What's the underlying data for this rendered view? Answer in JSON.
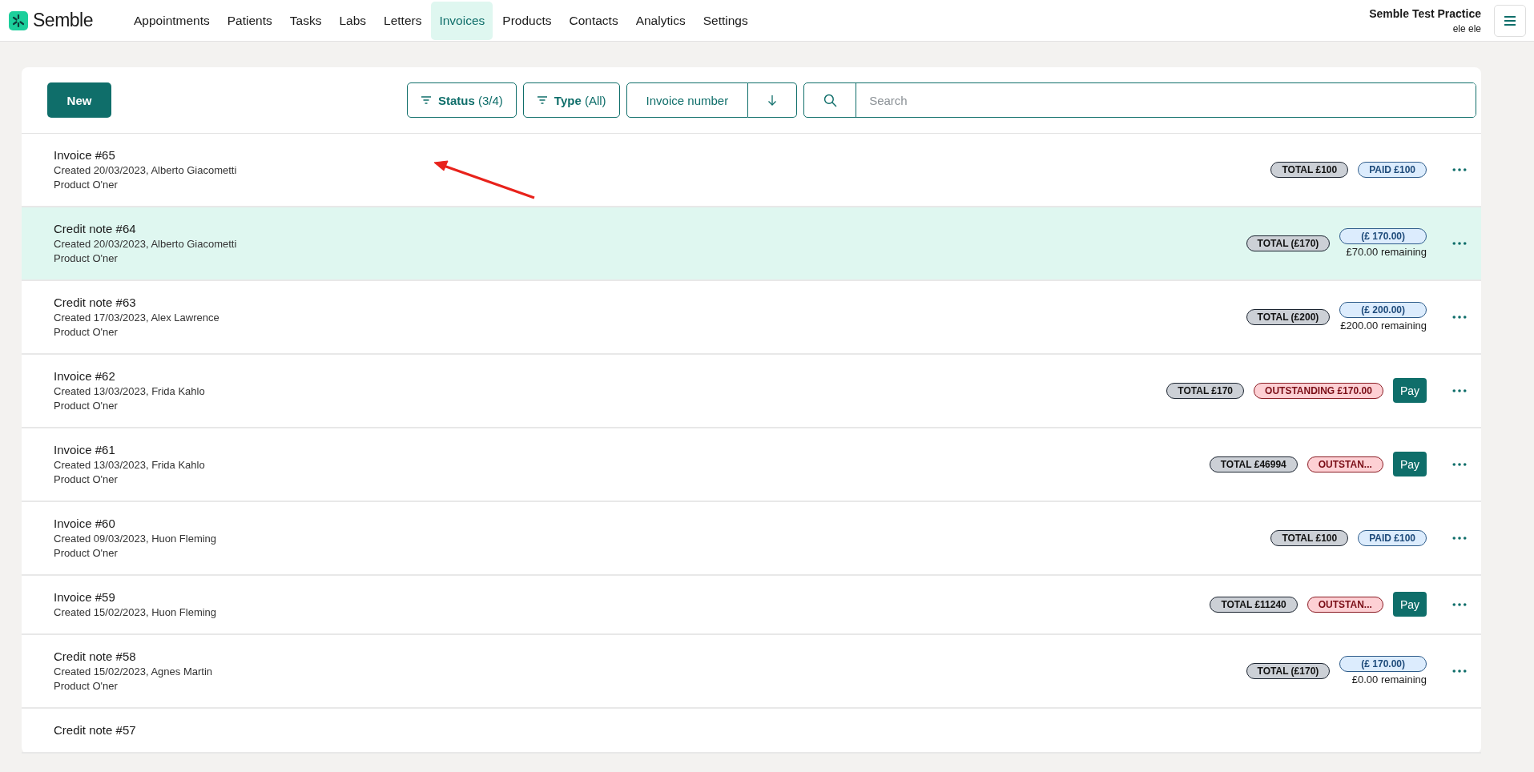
{
  "brand": {
    "name": "Semble"
  },
  "nav": [
    {
      "label": "Appointments",
      "selected": false
    },
    {
      "label": "Patients",
      "selected": false
    },
    {
      "label": "Tasks",
      "selected": false
    },
    {
      "label": "Labs",
      "selected": false
    },
    {
      "label": "Letters",
      "selected": false
    },
    {
      "label": "Invoices",
      "selected": true
    },
    {
      "label": "Products",
      "selected": false
    },
    {
      "label": "Contacts",
      "selected": false
    },
    {
      "label": "Analytics",
      "selected": false
    },
    {
      "label": "Settings",
      "selected": false
    }
  ],
  "account": {
    "practice": "Semble Test Practice",
    "user": "ele ele"
  },
  "toolbar": {
    "new_button": "New",
    "filters": [
      "**Status** (3/4)",
      "**Type** (All)"
    ],
    "sort": {
      "label": "Invoice number"
    },
    "search": {
      "placeholder": "Search"
    }
  },
  "rows": [
    {
      "title": "Invoice #65",
      "created": "Created 20/03/2023, Alberto Giacometti",
      "product": "Product O'ner",
      "selected": false,
      "badges": [
        {
          "kind": "total",
          "text": "TOTAL £100"
        },
        {
          "kind": "paid",
          "text": "PAID £100"
        }
      ]
    },
    {
      "title": "Credit note #64",
      "created": "Created 20/03/2023, Alberto Giacometti",
      "product": "Product O'ner",
      "selected": true,
      "badges": [
        {
          "kind": "total",
          "text": "TOTAL (£170)"
        },
        {
          "kind": "credit",
          "text": "(£ 170.00)",
          "remaining": "£70.00 remaining"
        }
      ]
    },
    {
      "title": "Credit note #63",
      "created": "Created 17/03/2023, Alex Lawrence",
      "product": "Product O'ner",
      "selected": false,
      "badges": [
        {
          "kind": "total",
          "text": "TOTAL (£200)"
        },
        {
          "kind": "credit",
          "text": "(£ 200.00)",
          "remaining": "£200.00 remaining"
        }
      ]
    },
    {
      "title": "Invoice #62",
      "created": "Created 13/03/2023, Frida Kahlo",
      "product": "Product O'ner",
      "selected": false,
      "badges": [
        {
          "kind": "total",
          "text": "TOTAL £170"
        },
        {
          "kind": "outstanding",
          "text": "OUTSTANDING £170.00"
        }
      ],
      "pay": "Pay"
    },
    {
      "title": "Invoice #61",
      "created": "Created 13/03/2023, Frida Kahlo",
      "product": "Product O'ner",
      "selected": false,
      "badges": [
        {
          "kind": "total",
          "text": "TOTAL £46994"
        },
        {
          "kind": "outstanding",
          "text": "OUTSTAN..."
        }
      ],
      "pay": "Pay"
    },
    {
      "title": "Invoice #60",
      "created": "Created 09/03/2023, Huon Fleming",
      "product": "Product O'ner",
      "selected": false,
      "badges": [
        {
          "kind": "total",
          "text": "TOTAL £100"
        },
        {
          "kind": "paid",
          "text": "PAID £100"
        }
      ]
    },
    {
      "title": "Invoice #59",
      "created": "Created 15/02/2023, Huon Fleming",
      "selected": false,
      "badges": [
        {
          "kind": "total",
          "text": "TOTAL £11240"
        },
        {
          "kind": "outstanding",
          "text": "OUTSTAN..."
        }
      ],
      "pay": "Pay"
    },
    {
      "title": "Credit note #58",
      "created": "Created 15/02/2023, Agnes Martin",
      "product": "Product O'ner",
      "selected": false,
      "badges": [
        {
          "kind": "total",
          "text": "TOTAL (£170)"
        },
        {
          "kind": "credit",
          "text": "(£ 170.00)",
          "remaining": "£0.00 remaining"
        }
      ]
    },
    {
      "title": "Credit note #57",
      "selected": false,
      "badges": []
    }
  ]
}
